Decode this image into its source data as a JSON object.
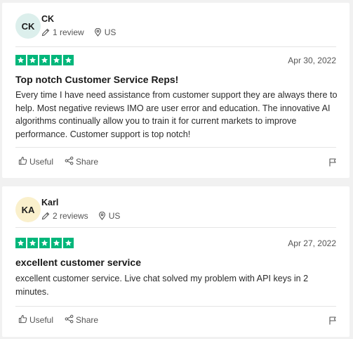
{
  "colors": {
    "star": "#00b67a",
    "avatar_ck": "#dcefec",
    "avatar_ka": "#faf0cc"
  },
  "reviews": [
    {
      "initials": "CK",
      "name": "CK",
      "review_count": "1 review",
      "country": "US",
      "rating": 5,
      "date": "Apr 30, 2022",
      "title": "Top notch Customer Service Reps!",
      "body": "Every time I have need assistance from customer support they are always there to help. Most negative reviews IMO are user error and education. The innovative AI algorithms continually allow you to train it for current markets to improve performance. Customer support is top notch!",
      "useful_label": "Useful",
      "share_label": "Share"
    },
    {
      "initials": "KA",
      "name": "Karl",
      "review_count": "2 reviews",
      "country": "US",
      "rating": 5,
      "date": "Apr 27, 2022",
      "title": "excellent customer service",
      "body": "excellent customer service. Live chat solved my problem with API keys in 2 minutes.",
      "useful_label": "Useful",
      "share_label": "Share"
    }
  ]
}
